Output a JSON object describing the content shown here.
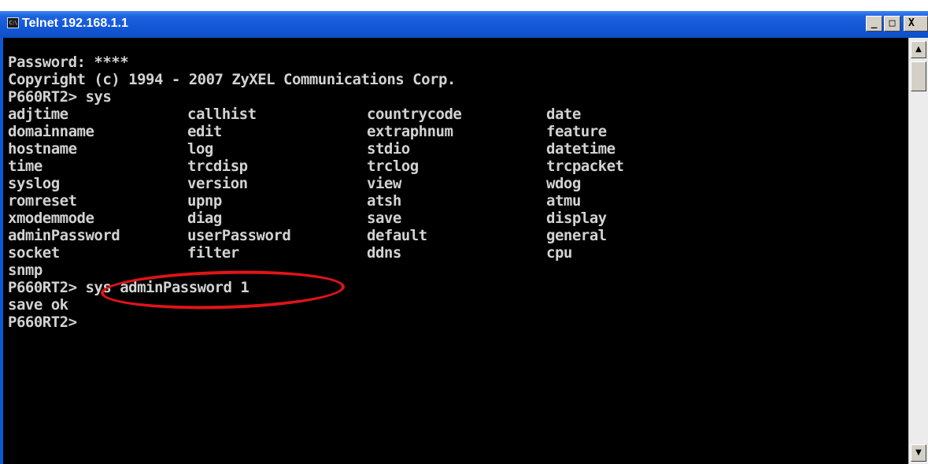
{
  "window": {
    "title": "Telnet 192.168.1.1",
    "icon": "console-icon",
    "icon_glyph": "C:\\",
    "controls": {
      "minimize": "_",
      "maximize": "□",
      "close": "X"
    }
  },
  "console": {
    "lines": [
      "Password: ****",
      "Copyright (c) 1994 - 2007 ZyXEL Communications Corp.",
      "P660RT2> sys"
    ],
    "commands": [
      [
        "adjtime",
        "callhist",
        "countrycode",
        "date"
      ],
      [
        "domainname",
        "edit",
        "extraphnum",
        "feature"
      ],
      [
        "hostname",
        "log",
        "stdio",
        "datetime"
      ],
      [
        "time",
        "trcdisp",
        "trclog",
        "trcpacket"
      ],
      [
        "syslog",
        "version",
        "view",
        "wdog"
      ],
      [
        "romreset",
        "upnp",
        "atsh",
        "atmu"
      ],
      [
        "xmodemmode",
        "diag",
        "save",
        "display"
      ],
      [
        "adminPassword",
        "userPassword",
        "default",
        "general"
      ],
      [
        "socket",
        "filter",
        "ddns",
        "cpu"
      ],
      [
        "snmp"
      ]
    ],
    "after": [
      "P660RT2> sys adminPassword 1",
      "save ok",
      "P660RT2>"
    ]
  },
  "scrollbar": {
    "up_arrow": "▲",
    "down_arrow": "▼"
  },
  "colors": {
    "title_bar": "#1358d8",
    "console_bg": "#000000",
    "console_text": "#d2d2d2",
    "highlight": "#e01418"
  }
}
